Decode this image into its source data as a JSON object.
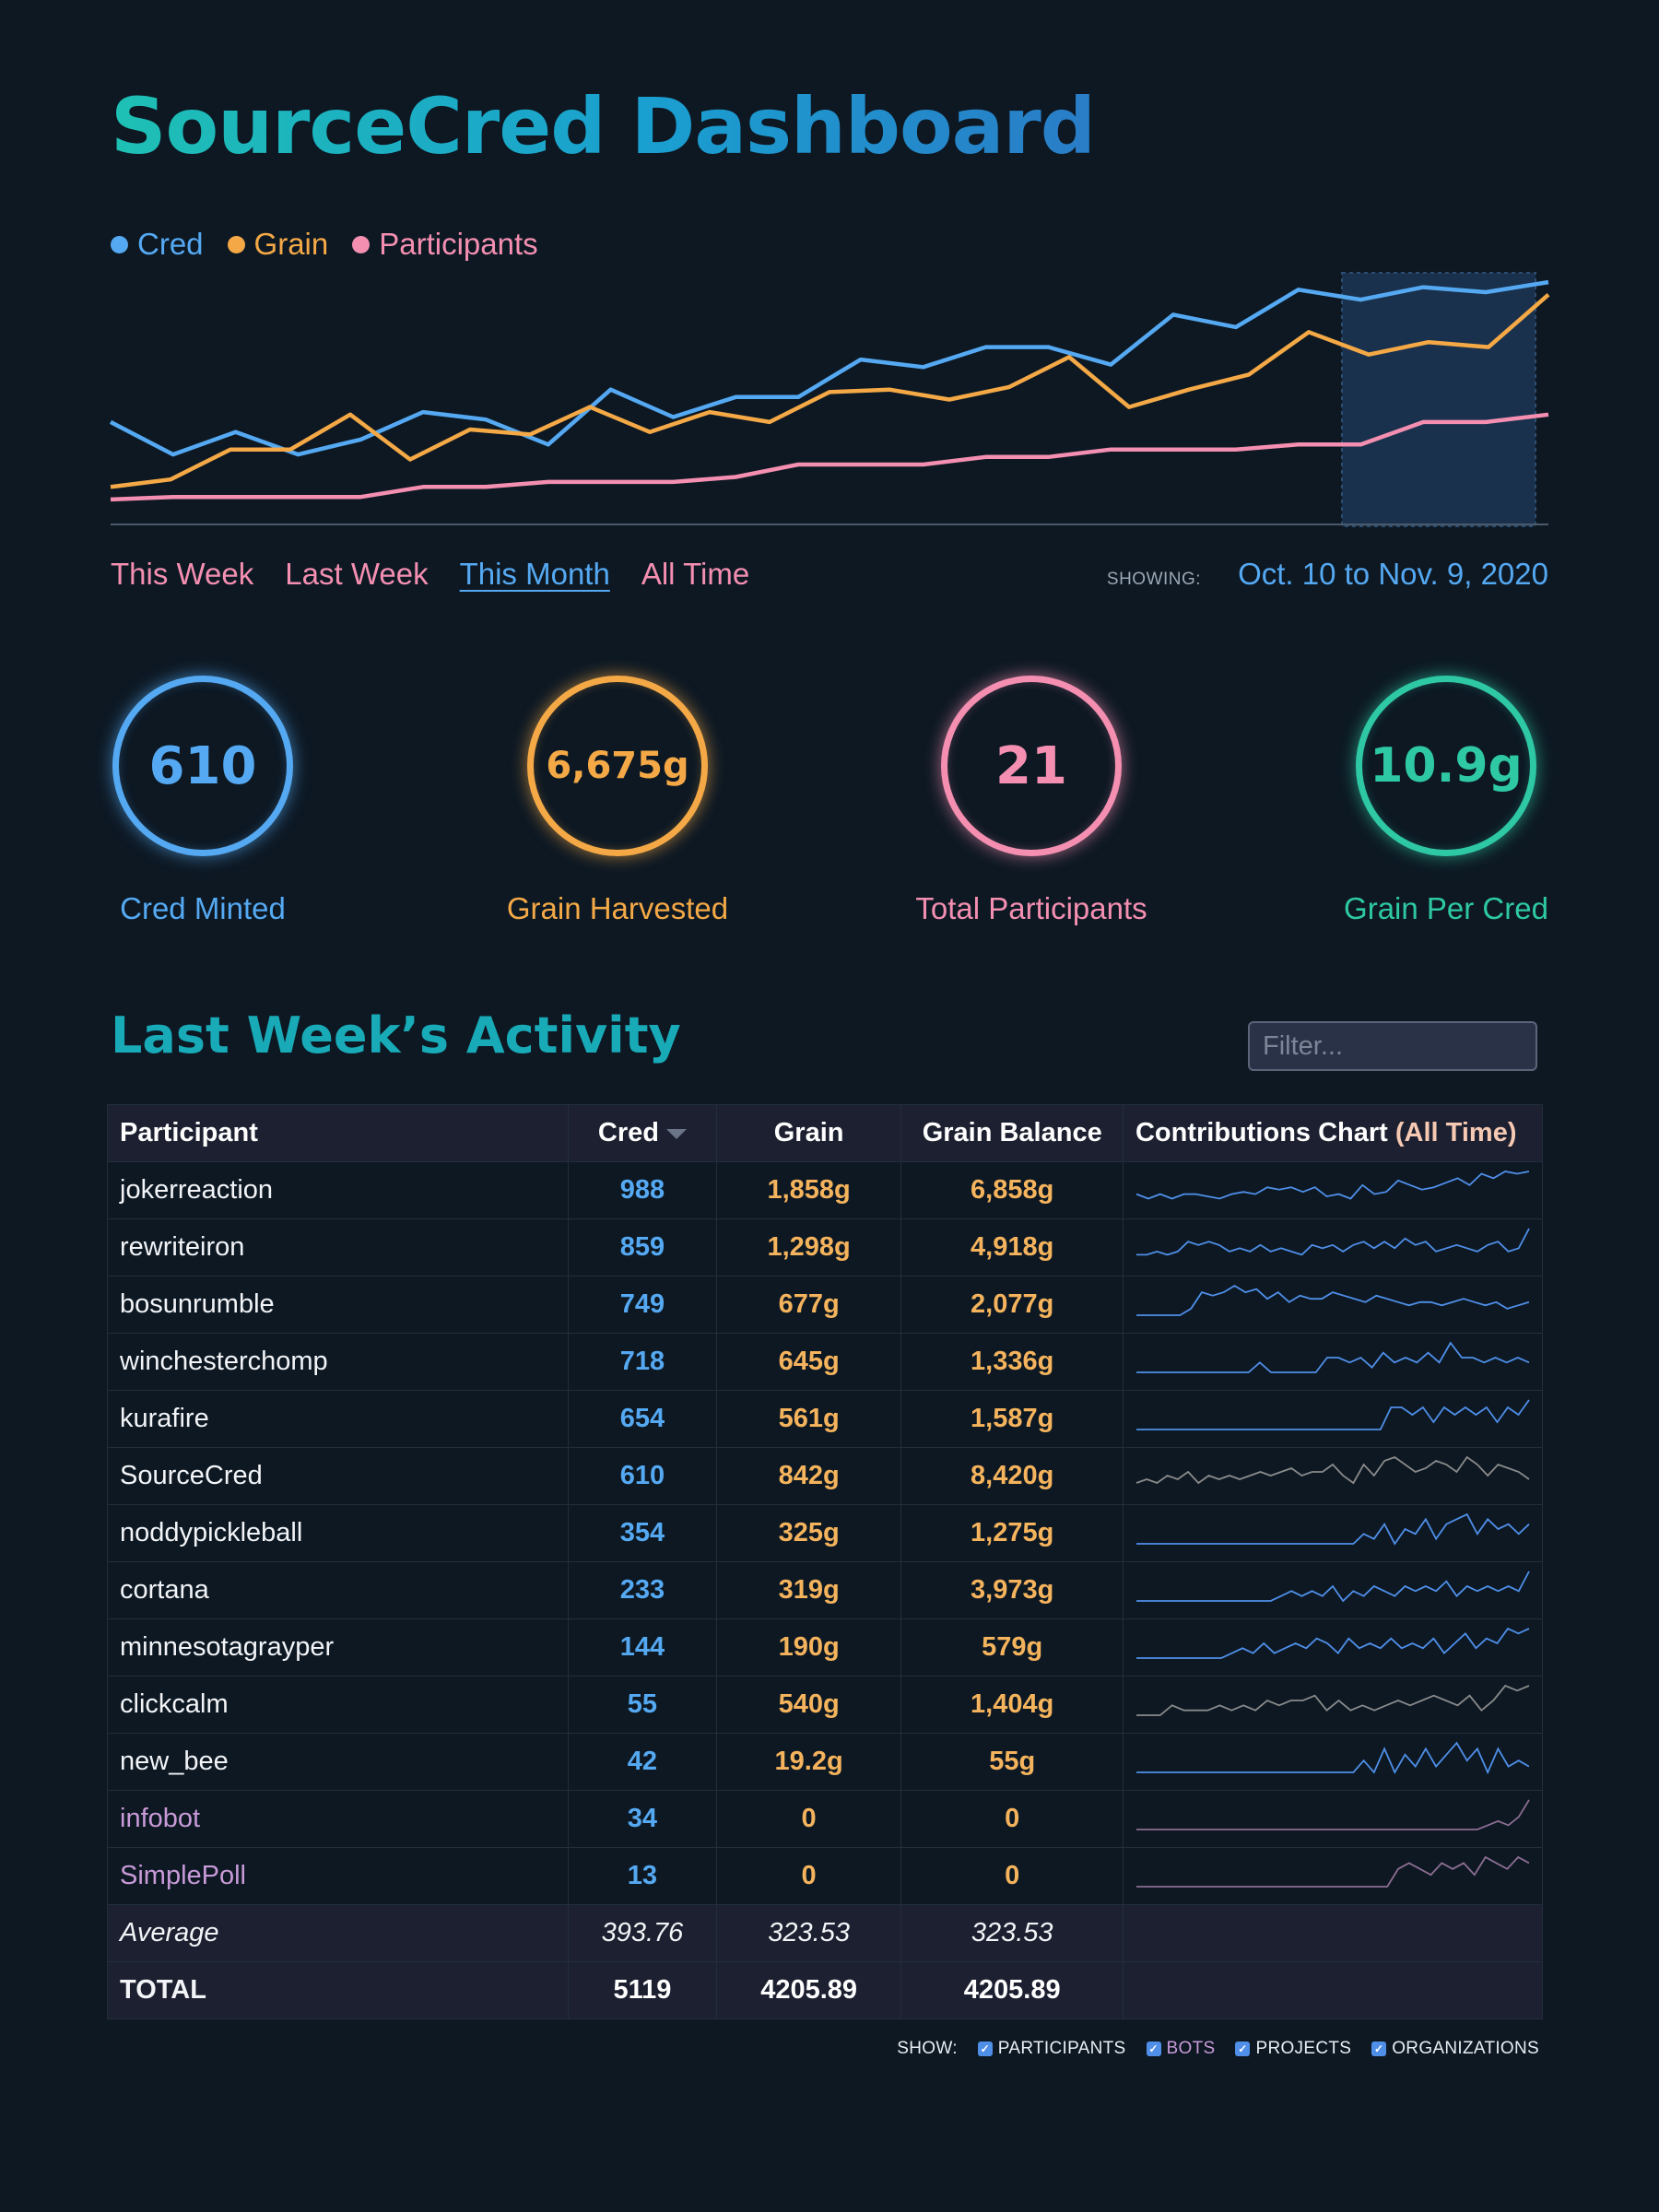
{
  "header": {
    "title": "SourceCred Dashboard"
  },
  "legend": [
    {
      "label": "Cred",
      "color": "#55a9f2"
    },
    {
      "label": "Grain",
      "color": "#f4a946"
    },
    {
      "label": "Participants",
      "color": "#f48fb1"
    }
  ],
  "chart_data": {
    "type": "line",
    "title": "",
    "xlabel": "",
    "ylabel": "",
    "grid": false,
    "legend_position": "top-left",
    "highlight_last_points": 3,
    "ylim": [
      0,
      100
    ],
    "series": [
      {
        "name": "Cred",
        "color": "#55a9f2",
        "values": [
          41,
          28,
          37,
          28,
          34,
          45,
          42,
          32,
          54,
          43,
          51,
          51,
          66,
          63,
          71,
          71,
          64,
          84,
          79,
          94,
          90,
          95,
          93,
          97
        ]
      },
      {
        "name": "Grain",
        "color": "#f4a946",
        "values": [
          15,
          18,
          30,
          30,
          44,
          26,
          38,
          36,
          47,
          37,
          45,
          41,
          53,
          54,
          50,
          55,
          67,
          47,
          54,
          60,
          77,
          68,
          73,
          71,
          92
        ]
      },
      {
        "name": "Participants",
        "color": "#f48fb1",
        "values": [
          10,
          11,
          11,
          11,
          11,
          15,
          15,
          17,
          17,
          17,
          19,
          24,
          24,
          24,
          27,
          27,
          30,
          30,
          30,
          32,
          32,
          41,
          41,
          44
        ]
      }
    ]
  },
  "ranges": {
    "items": [
      "This Week",
      "Last Week",
      "This Month",
      "All Time"
    ],
    "active_index": 2,
    "showing_label": "SHOWING:",
    "showing_value": "Oct. 10 to Nov. 9, 2020"
  },
  "stats": [
    {
      "value": "610",
      "label": "Cred Minted",
      "color": "#55a9f2"
    },
    {
      "value": "6,675g",
      "label": "Grain Harvested",
      "color": "#f4a946"
    },
    {
      "value": "21",
      "label": "Total Participants",
      "color": "#f48fb1"
    },
    {
      "value": "10.9g",
      "label": "Grain Per Cred",
      "color": "#2ec9a4"
    }
  ],
  "activity": {
    "title": "Last Week’s Activity",
    "filter_placeholder": "Filter...",
    "headers": {
      "participant": "Participant",
      "cred": "Cred",
      "grain": "Grain",
      "balance": "Grain Balance",
      "chart": "Contributions Chart",
      "chart_suffix": "(All Time)"
    },
    "rows": [
      {
        "name": "jokerreaction",
        "cred": "988",
        "grain": "1,858g",
        "balance": "6,858g",
        "kind": "user",
        "spark": [
          3,
          1,
          3,
          1,
          3,
          3,
          2,
          1,
          3,
          4,
          3,
          6,
          5,
          6,
          4,
          6,
          2,
          3,
          1,
          7,
          3,
          4,
          9,
          7,
          5,
          6,
          8,
          10,
          7,
          12,
          10,
          13,
          12,
          13
        ]
      },
      {
        "name": "rewriteiron",
        "cred": "859",
        "grain": "1,298g",
        "balance": "4,918g",
        "kind": "user",
        "spark": [
          1,
          1,
          2,
          1,
          2,
          5,
          4,
          5,
          4,
          2,
          3,
          2,
          4,
          2,
          3,
          2,
          1,
          4,
          3,
          4,
          2,
          4,
          5,
          3,
          5,
          3,
          6,
          4,
          5,
          2,
          3,
          4,
          3,
          2,
          4,
          5,
          2,
          3,
          9
        ]
      },
      {
        "name": "bosunrumble",
        "cred": "749",
        "grain": "677g",
        "balance": "2,077g",
        "kind": "user",
        "spark": [
          0,
          0,
          0,
          0,
          0,
          2,
          7,
          6,
          7,
          9,
          7,
          8,
          5,
          7,
          4,
          6,
          5,
          5,
          7,
          6,
          5,
          4,
          6,
          5,
          4,
          3,
          4,
          4,
          3,
          4,
          5,
          4,
          3,
          4,
          2,
          3,
          4
        ]
      },
      {
        "name": "winchesterchomp",
        "cred": "718",
        "grain": "645g",
        "balance": "1,336g",
        "kind": "user",
        "spark": [
          0,
          0,
          0,
          0,
          0,
          0,
          0,
          0,
          0,
          0,
          0,
          2,
          0,
          0,
          0,
          0,
          0,
          3,
          3,
          2,
          3,
          1,
          4,
          2,
          3,
          2,
          4,
          2,
          6,
          3,
          3,
          2,
          3,
          2,
          3,
          2
        ]
      },
      {
        "name": "kurafire",
        "cred": "654",
        "grain": "561g",
        "balance": "1,587g",
        "kind": "user",
        "spark": [
          0,
          0,
          0,
          0,
          0,
          0,
          0,
          0,
          0,
          0,
          0,
          0,
          0,
          0,
          0,
          0,
          0,
          0,
          0,
          0,
          0,
          0,
          0,
          0,
          3,
          3,
          2,
          3,
          1,
          3,
          2,
          3,
          2,
          3,
          1,
          3,
          2,
          4
        ]
      },
      {
        "name": "SourceCred",
        "cred": "610",
        "grain": "842g",
        "balance": "8,420g",
        "kind": "project",
        "spark": [
          1,
          2,
          1,
          3,
          2,
          4,
          1,
          3,
          2,
          3,
          2,
          3,
          4,
          3,
          4,
          5,
          3,
          4,
          4,
          6,
          3,
          1,
          6,
          3,
          7,
          8,
          6,
          4,
          5,
          7,
          6,
          4,
          8,
          6,
          3,
          6,
          5,
          4,
          2
        ]
      },
      {
        "name": "noddypickleball",
        "cred": "354",
        "grain": "325g",
        "balance": "1,275g",
        "kind": "user",
        "spark": [
          0,
          0,
          0,
          0,
          0,
          0,
          0,
          0,
          0,
          0,
          0,
          0,
          0,
          0,
          0,
          0,
          0,
          0,
          0,
          0,
          0,
          0,
          2,
          1,
          4,
          0,
          3,
          2,
          5,
          1,
          4,
          5,
          6,
          2,
          5,
          3,
          4,
          2,
          4
        ]
      },
      {
        "name": "cortana",
        "cred": "233",
        "grain": "319g",
        "balance": "3,973g",
        "kind": "user",
        "spark": [
          0,
          0,
          0,
          0,
          0,
          0,
          0,
          0,
          0,
          0,
          0,
          0,
          0,
          0,
          1,
          2,
          1,
          2,
          1,
          3,
          0,
          2,
          1,
          3,
          2,
          1,
          3,
          2,
          3,
          2,
          4,
          1,
          3,
          2,
          3,
          2,
          3,
          2,
          6
        ]
      },
      {
        "name": "minnesotagrayper",
        "cred": "144",
        "grain": "190g",
        "balance": "579g",
        "kind": "user",
        "spark": [
          0,
          0,
          0,
          0,
          0,
          0,
          0,
          0,
          0,
          1,
          2,
          1,
          3,
          1,
          2,
          3,
          2,
          4,
          3,
          1,
          4,
          2,
          3,
          2,
          4,
          2,
          3,
          2,
          4,
          1,
          3,
          5,
          2,
          4,
          3,
          6,
          5,
          6
        ]
      },
      {
        "name": "clickcalm",
        "cred": "55",
        "grain": "540g",
        "balance": "1,404g",
        "kind": "org",
        "spark": [
          0,
          0,
          0,
          2,
          1,
          1,
          1,
          2,
          1,
          2,
          1,
          3,
          2,
          3,
          3,
          4,
          1,
          3,
          1,
          2,
          1,
          2,
          3,
          2,
          3,
          4,
          3,
          2,
          4,
          1,
          3,
          6,
          5,
          6
        ]
      },
      {
        "name": "new_bee",
        "cred": "42",
        "grain": "19.2g",
        "balance": "55g",
        "kind": "user",
        "spark": [
          0,
          0,
          0,
          0,
          0,
          0,
          0,
          0,
          0,
          0,
          0,
          0,
          0,
          0,
          0,
          0,
          0,
          0,
          0,
          0,
          0,
          0,
          2,
          0,
          4,
          0,
          3,
          1,
          4,
          1,
          3,
          5,
          2,
          4,
          0,
          4,
          1,
          2,
          1
        ]
      },
      {
        "name": "infobot",
        "cred": "34",
        "grain": "0",
        "balance": "0",
        "kind": "bot",
        "spark": [
          0,
          0,
          0,
          0,
          0,
          0,
          0,
          0,
          0,
          0,
          0,
          0,
          0,
          0,
          0,
          0,
          0,
          0,
          0,
          0,
          0,
          0,
          0,
          0,
          0,
          0,
          0,
          0,
          0,
          0,
          0,
          0,
          0,
          0,
          1,
          2,
          1,
          3,
          7
        ]
      },
      {
        "name": "SimplePoll",
        "cred": "13",
        "grain": "0",
        "balance": "0",
        "kind": "bot",
        "spark": [
          0,
          0,
          0,
          0,
          0,
          0,
          0,
          0,
          0,
          0,
          0,
          0,
          0,
          0,
          0,
          0,
          0,
          0,
          0,
          0,
          0,
          0,
          0,
          0,
          3,
          4,
          3,
          2,
          4,
          3,
          4,
          2,
          5,
          4,
          3,
          5,
          4
        ]
      }
    ],
    "average": {
      "label": "Average",
      "cred": "393.76",
      "grain": "323.53",
      "balance": "323.53"
    },
    "total": {
      "label": "TOTAL",
      "cred": "5119",
      "grain": "4205.89",
      "balance": "4205.89"
    }
  },
  "show": {
    "label": "SHOW:",
    "options": [
      {
        "label": "PARTICIPANTS",
        "checked": true
      },
      {
        "label": "BOTS",
        "checked": true
      },
      {
        "label": "PROJECTS",
        "checked": true
      },
      {
        "label": "ORGANIZATIONS",
        "checked": true
      }
    ]
  },
  "colors": {
    "background": "#0d1823",
    "spark_user": "#4f8fe8",
    "spark_project": "#8a8a8a",
    "spark_bot": "#8c6d92"
  }
}
